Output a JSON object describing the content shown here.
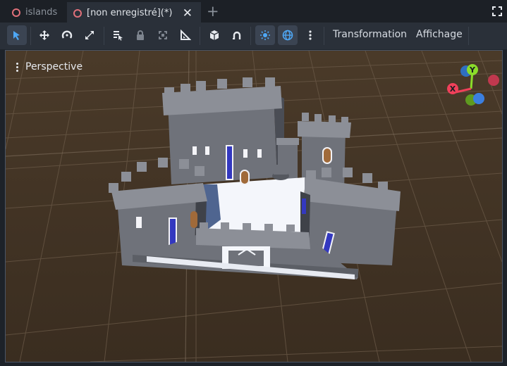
{
  "tabs": [
    {
      "label": "islands"
    },
    {
      "label": "[non enregistré](*)"
    }
  ],
  "tab_close_glyph": "✕",
  "new_tab_glyph": "+",
  "toolbar": {
    "tools": [
      {
        "name": "select-tool",
        "icon": "pointer-icon",
        "active": true
      },
      {
        "name": "move-tool",
        "icon": "move-arrows-icon",
        "active": false
      },
      {
        "name": "rotate-tool",
        "icon": "rotate-icon",
        "active": false
      },
      {
        "name": "scale-tool",
        "icon": "scale-icon",
        "active": false
      },
      {
        "name": "list-select-tool",
        "icon": "list-select-icon",
        "active": false
      },
      {
        "name": "lock-tool",
        "icon": "lock-icon",
        "active": false
      },
      {
        "name": "group-tool",
        "icon": "group-icon",
        "active": false
      },
      {
        "name": "ruler-tool",
        "icon": "ruler-icon",
        "active": false
      },
      {
        "name": "local-space-toggle",
        "icon": "cube-icon",
        "active": false
      },
      {
        "name": "snap-toggle",
        "icon": "magnet-icon",
        "active": false
      },
      {
        "name": "sun-toggle",
        "icon": "sun-icon",
        "active": true
      },
      {
        "name": "environment-toggle",
        "icon": "globe-icon",
        "active": true
      }
    ],
    "menus": {
      "transform": "Transformation",
      "view": "Affichage"
    }
  },
  "viewport": {
    "mode_label": "Perspective"
  },
  "gizmo": {
    "x_label": "X",
    "y_label": "Y",
    "colors": {
      "x": "#f0405a",
      "y": "#8bdc2a",
      "z": "#3b7fe0"
    }
  },
  "colors": {
    "accent": "#4ea7f5",
    "ground": "#3f3123",
    "castle_stone": "#8a8d95",
    "castle_banner": "#2a2ea8"
  }
}
